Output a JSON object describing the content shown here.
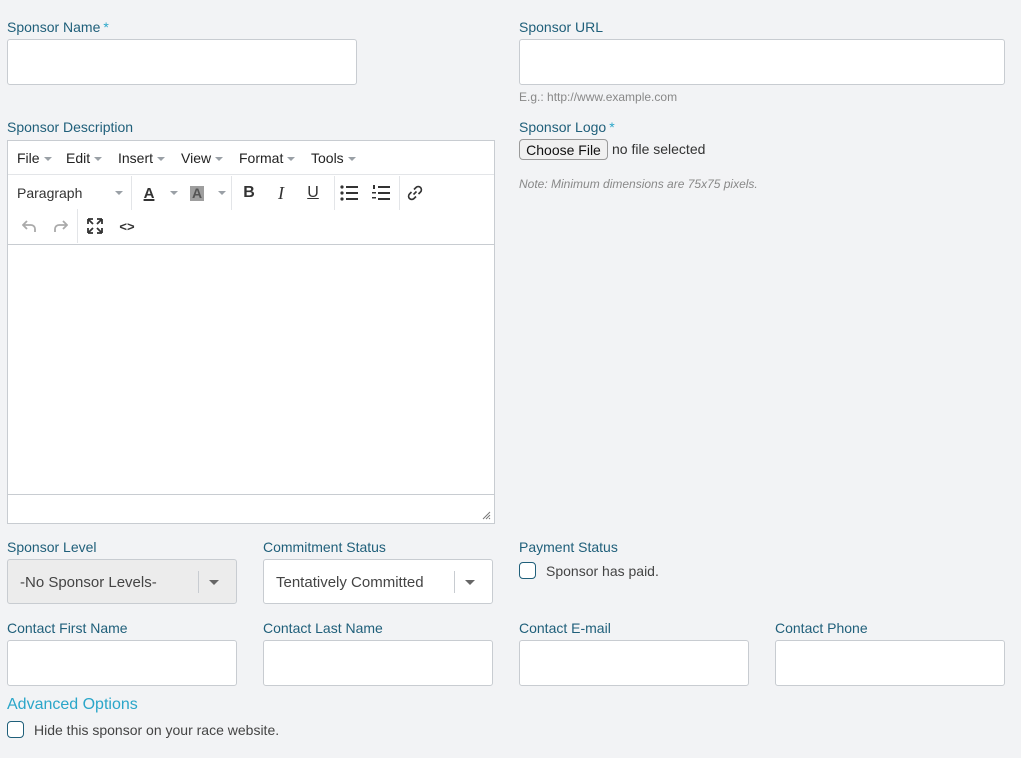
{
  "fields": {
    "sponsor_name": {
      "label": "Sponsor Name",
      "required": "*",
      "value": ""
    },
    "sponsor_url": {
      "label": "Sponsor URL",
      "value": "",
      "hint": "E.g.: http://www.example.com"
    },
    "sponsor_description": {
      "label": "Sponsor Description"
    },
    "sponsor_logo": {
      "label": "Sponsor Logo",
      "required": "*",
      "button": "Choose File",
      "status": "no file selected",
      "note": "Note: Minimum dimensions are 75x75 pixels."
    },
    "sponsor_level": {
      "label": "Sponsor Level",
      "value": "-No Sponsor Levels-"
    },
    "commitment_status": {
      "label": "Commitment Status",
      "value": "Tentatively Committed"
    },
    "payment_status": {
      "label": "Payment Status",
      "checkbox_label": "Sponsor has paid."
    },
    "contact_first_name": {
      "label": "Contact First Name",
      "value": ""
    },
    "contact_last_name": {
      "label": "Contact Last Name",
      "value": ""
    },
    "contact_email": {
      "label": "Contact E-mail",
      "value": ""
    },
    "contact_phone": {
      "label": "Contact Phone",
      "value": ""
    }
  },
  "editor": {
    "menu": [
      "File",
      "Edit",
      "Insert",
      "View",
      "Format",
      "Tools"
    ],
    "block_format": "Paragraph",
    "icons": {
      "text_color": "A",
      "bg_color": "A",
      "bold": "B",
      "italic": "I",
      "underline": "U",
      "code": "<>"
    }
  },
  "advanced": {
    "title": "Advanced Options",
    "hide_label": "Hide this sponsor on your race website."
  },
  "colors": {
    "label": "#1f5f7a",
    "accent": "#2aa6c9",
    "background": "#f2f3f5"
  }
}
